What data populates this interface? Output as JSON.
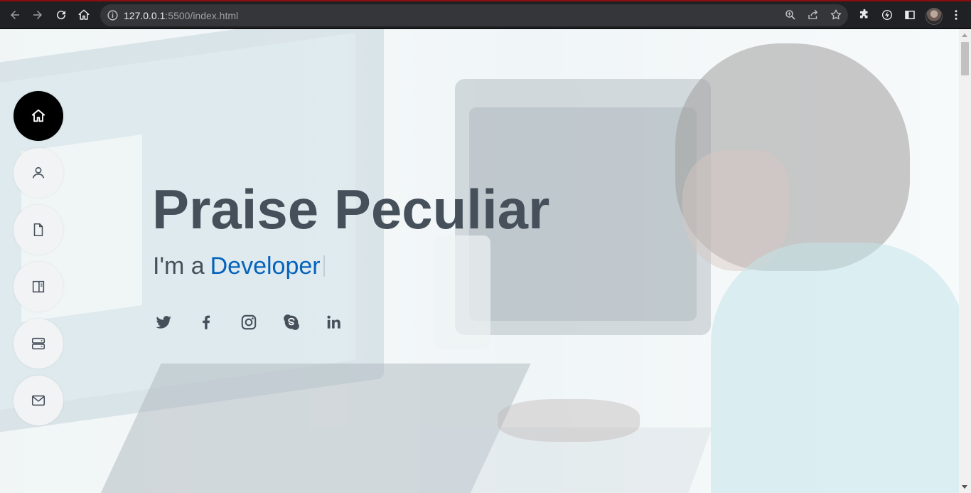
{
  "browser": {
    "url_host": "127.0.0.1",
    "url_rest": ":5500/index.html",
    "colors": {
      "frame": "#202124",
      "omnibox": "#35363a",
      "icon": "#e8eaed"
    }
  },
  "nav": {
    "items": [
      {
        "icon": "home-icon",
        "active": true
      },
      {
        "icon": "user-icon",
        "active": false
      },
      {
        "icon": "file-icon",
        "active": false
      },
      {
        "icon": "book-icon",
        "active": false
      },
      {
        "icon": "server-icon",
        "active": false
      },
      {
        "icon": "envelope-icon",
        "active": false
      }
    ]
  },
  "hero": {
    "name": "Praise Peculiar",
    "subtitle_prefix": "I'm a",
    "subtitle_typed": "Developer",
    "colors": {
      "text": "#45505b",
      "accent": "#0563bb"
    }
  },
  "social": [
    "twitter-icon",
    "facebook-icon",
    "instagram-icon",
    "skype-icon",
    "linkedin-icon"
  ]
}
